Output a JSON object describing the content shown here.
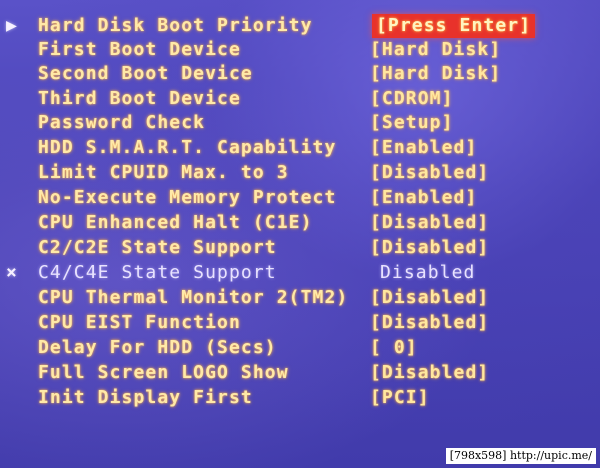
{
  "menu": {
    "items": [
      {
        "label": "Hard Disk Boot Priority",
        "value": "[Press Enter]",
        "marker": "▶",
        "selected": true,
        "disabled": false
      },
      {
        "label": "First Boot Device",
        "value": "[Hard Disk]",
        "marker": "",
        "selected": false,
        "disabled": false
      },
      {
        "label": "Second Boot Device",
        "value": "[Hard Disk]",
        "marker": "",
        "selected": false,
        "disabled": false
      },
      {
        "label": "Third Boot Device",
        "value": "[CDROM]",
        "marker": "",
        "selected": false,
        "disabled": false
      },
      {
        "label": "Password Check",
        "value": "[Setup]",
        "marker": "",
        "selected": false,
        "disabled": false
      },
      {
        "label": "HDD S.M.A.R.T. Capability",
        "value": "[Enabled]",
        "marker": "",
        "selected": false,
        "disabled": false
      },
      {
        "label": "Limit CPUID Max. to 3",
        "value": "[Disabled]",
        "marker": "",
        "selected": false,
        "disabled": false
      },
      {
        "label": "No-Execute Memory Protect",
        "value": "[Enabled]",
        "marker": "",
        "selected": false,
        "disabled": false
      },
      {
        "label": "CPU Enhanced Halt (C1E)",
        "value": "[Disabled]",
        "marker": "",
        "selected": false,
        "disabled": false
      },
      {
        "label": "C2/C2E State Support",
        "value": "[Disabled]",
        "marker": "",
        "selected": false,
        "disabled": false
      },
      {
        "label": "C4/C4E State Support",
        "value": "Disabled",
        "marker": "×",
        "selected": false,
        "disabled": true
      },
      {
        "label": "CPU Thermal Monitor 2(TM2)",
        "value": "[Disabled]",
        "marker": "",
        "selected": false,
        "disabled": false
      },
      {
        "label": "CPU EIST Function",
        "value": "[Disabled]",
        "marker": "",
        "selected": false,
        "disabled": false
      },
      {
        "label": "Delay For HDD (Secs)",
        "value": "[ 0]",
        "marker": "",
        "selected": false,
        "disabled": false
      },
      {
        "label": "Full Screen LOGO Show",
        "value": "[Disabled]",
        "marker": "",
        "selected": false,
        "disabled": false
      },
      {
        "label": "Init Display First",
        "value": "[PCI]",
        "marker": "",
        "selected": false,
        "disabled": false
      }
    ]
  },
  "watermark": "[798x598] http://upic.me/",
  "colors": {
    "background": "#4a43b6",
    "text": "#ffe9a8",
    "selected_bg": "#e8322b",
    "disabled_text": "#e8e2ff"
  }
}
